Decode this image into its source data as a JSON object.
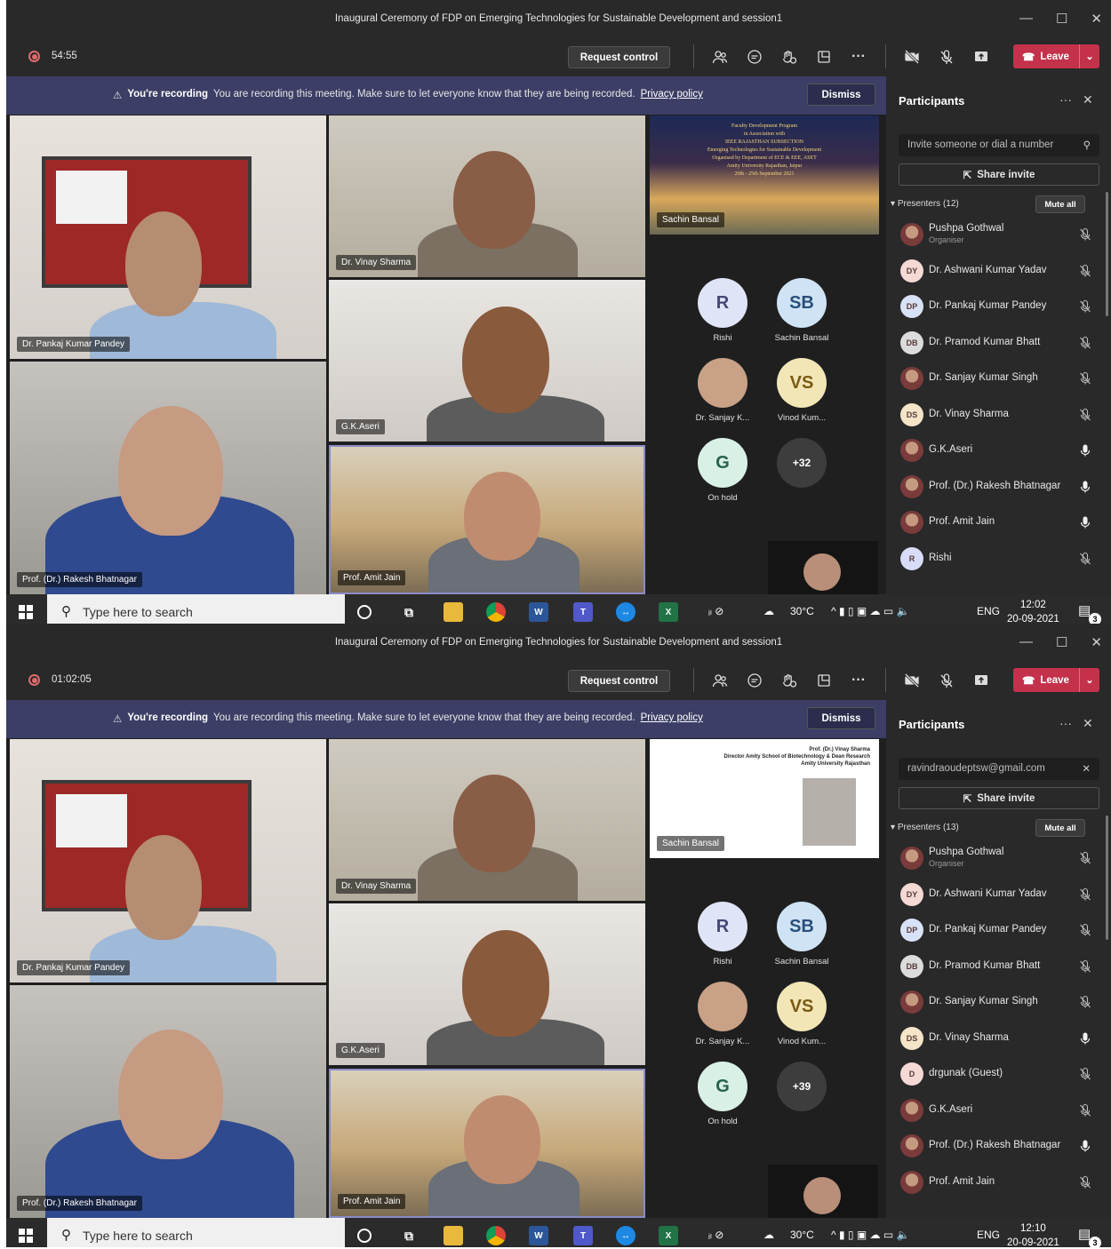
{
  "colors": {
    "recording_red": "#e06b6b",
    "leave_red": "#c4314b",
    "banner": "#3d3e66",
    "dark": "#292929"
  },
  "shots": [
    {
      "title": "Inaugural Ceremony of FDP on Emerging Technologies for Sustainable Development and session1",
      "timer": "54:55",
      "request_control": "Request control",
      "leave": "Leave",
      "banner": {
        "heading": "You're recording",
        "message": "You are recording this meeting. Make sure to let everyone know that they are being recorded.",
        "link": "Privacy policy",
        "dismiss": "Dismiss"
      },
      "tiles": {
        "t1": "Dr. Pankaj Kumar Pandey",
        "t2": "Dr. Vinay Sharma",
        "t3": "G.K.Aseri",
        "t4": "Prof. (Dr.) Rakesh Bhatnagar",
        "t5": "Prof. Amit Jain",
        "screen": "Sachin Bansal"
      },
      "slide_lines": [
        "Faculty Development Program",
        "in Association with",
        "IEEE RAJASTHAN SUBSECTION",
        "Emerging Technologies for Sustainable Development",
        "Organised by Department of ECE & EEE, ASET",
        "Amity University Rajasthan, Jaipur",
        "20th - 25th September 2021"
      ],
      "roster": [
        {
          "initials": "R",
          "name": "Rishi"
        },
        {
          "initials": "SB",
          "name": "Sachin Bansal"
        },
        {
          "initials": "",
          "name": "Dr. Sanjay K..."
        },
        {
          "initials": "VS",
          "name": "Vinod Kum..."
        },
        {
          "initials": "G",
          "name": "On hold"
        },
        {
          "initials": "+32",
          "name": ""
        }
      ],
      "panel": {
        "title": "Participants",
        "invite": "Invite someone or dial a number",
        "share": "Share invite",
        "presenters": "Presenters (12)",
        "mute_all": "Mute all",
        "organiser": "Organiser",
        "people": [
          {
            "initials": "",
            "name": "Pushpa Gothwal",
            "mic": "off"
          },
          {
            "initials": "DY",
            "name": "Dr. Ashwani Kumar Yadav",
            "mic": "off"
          },
          {
            "initials": "DP",
            "name": "Dr. Pankaj Kumar Pandey",
            "mic": "off"
          },
          {
            "initials": "DB",
            "name": "Dr. Pramod Kumar Bhatt",
            "mic": "off"
          },
          {
            "initials": "",
            "name": "Dr. Sanjay Kumar Singh",
            "mic": "off"
          },
          {
            "initials": "DS",
            "name": "Dr. Vinay Sharma",
            "mic": "off"
          },
          {
            "initials": "",
            "name": "G.K.Aseri",
            "mic": "on"
          },
          {
            "initials": "",
            "name": "Prof. (Dr.) Rakesh Bhatnagar",
            "mic": "on"
          },
          {
            "initials": "",
            "name": "Prof. Amit Jain",
            "mic": "on"
          },
          {
            "initials": "R",
            "name": "Rishi",
            "mic": "off"
          }
        ]
      },
      "taskbar": {
        "search": "Type here to search",
        "weather": "30°C",
        "lang": "ENG",
        "time": "12:02",
        "date": "20-09-2021",
        "notifications": "3"
      }
    },
    {
      "title": "Inaugural Ceremony of FDP on Emerging Technologies for Sustainable Development and session1",
      "timer": "01:02:05",
      "request_control": "Request control",
      "leave": "Leave",
      "banner": {
        "heading": "You're recording",
        "message": "You are recording this meeting. Make sure to let everyone know that they are being recorded.",
        "link": "Privacy policy",
        "dismiss": "Dismiss"
      },
      "tiles": {
        "t1": "Dr. Pankaj Kumar Pandey",
        "t2": "Dr. Vinay Sharma",
        "t3": "G.K.Aseri",
        "t4": "Prof. (Dr.) Rakesh Bhatnagar",
        "t5": "Prof. Amit Jain",
        "screen": "Sachin Bansal"
      },
      "slide_lines": [
        "Prof. (Dr.) Vinay Sharma",
        "Director Amity School of Biotechnology & Dean Research",
        "Amity University Rajasthan"
      ],
      "roster": [
        {
          "initials": "R",
          "name": "Rishi"
        },
        {
          "initials": "SB",
          "name": "Sachin Bansal"
        },
        {
          "initials": "",
          "name": "Dr. Sanjay K..."
        },
        {
          "initials": "VS",
          "name": "Vinod Kum..."
        },
        {
          "initials": "G",
          "name": "On hold"
        },
        {
          "initials": "+39",
          "name": ""
        }
      ],
      "panel": {
        "title": "Participants",
        "invite": "ravindraoudeptsw@gmail.com",
        "share": "Share invite",
        "presenters": "Presenters (13)",
        "mute_all": "Mute all",
        "organiser": "Organiser",
        "people": [
          {
            "initials": "",
            "name": "Pushpa Gothwal",
            "mic": "off"
          },
          {
            "initials": "DY",
            "name": "Dr. Ashwani Kumar Yadav",
            "mic": "off"
          },
          {
            "initials": "DP",
            "name": "Dr. Pankaj Kumar Pandey",
            "mic": "off"
          },
          {
            "initials": "DB",
            "name": "Dr. Pramod Kumar Bhatt",
            "mic": "off"
          },
          {
            "initials": "",
            "name": "Dr. Sanjay Kumar Singh",
            "mic": "off"
          },
          {
            "initials": "DS",
            "name": "Dr. Vinay Sharma",
            "mic": "on"
          },
          {
            "initials": "D",
            "name": "drgunak (Guest)",
            "mic": "off"
          },
          {
            "initials": "",
            "name": "G.K.Aseri",
            "mic": "off"
          },
          {
            "initials": "",
            "name": "Prof. (Dr.) Rakesh Bhatnagar",
            "mic": "on"
          },
          {
            "initials": "",
            "name": "Prof. Amit Jain",
            "mic": "off"
          }
        ]
      },
      "taskbar": {
        "search": "Type here to search",
        "weather": "30°C",
        "lang": "ENG",
        "time": "12:10",
        "date": "20-09-2021",
        "notifications": "3"
      }
    }
  ]
}
